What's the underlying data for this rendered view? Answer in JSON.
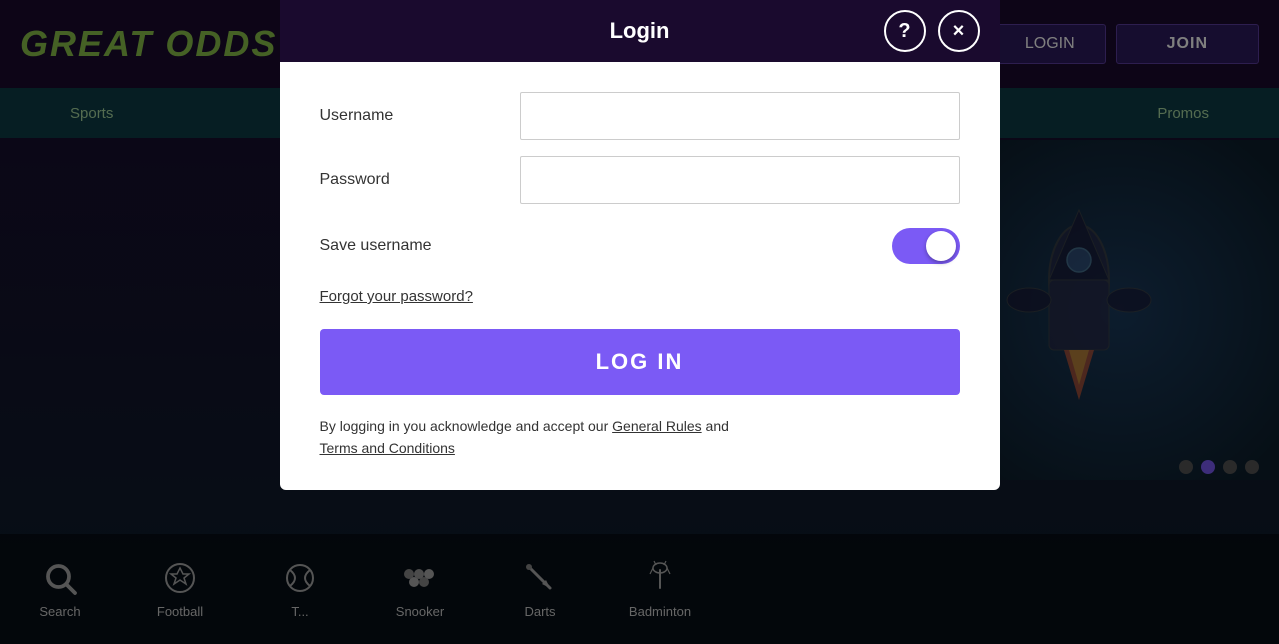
{
  "app": {
    "title": "Great Odds",
    "logo_text": "GREAT ODDS"
  },
  "header": {
    "login_label": "LOGIN",
    "join_label": "JOIN"
  },
  "nav": {
    "sports_label": "Sports",
    "promos_label": "Promos"
  },
  "sports_bar": {
    "items": [
      {
        "id": "search",
        "label": "Search",
        "icon": "search"
      },
      {
        "id": "football",
        "label": "Football",
        "icon": "football"
      },
      {
        "id": "tennis",
        "label": "T...",
        "icon": "tennis"
      },
      {
        "id": "snooker",
        "label": "Snooker",
        "icon": "snooker"
      },
      {
        "id": "darts",
        "label": "Darts",
        "icon": "darts"
      },
      {
        "id": "badminton",
        "label": "Badminton",
        "icon": "badminton"
      }
    ]
  },
  "modal": {
    "title": "Login",
    "username_label": "Username",
    "username_placeholder": "",
    "password_label": "Password",
    "password_placeholder": "",
    "save_username_label": "Save username",
    "toggle_on": true,
    "forgot_password_label": "Forgot your password?",
    "login_button_label": "LOG IN",
    "terms_text_prefix": "By logging in you acknowledge and accept our",
    "general_rules_label": "General Rules",
    "terms_and": "and",
    "terms_conditions_label": "Terms and Conditions",
    "help_icon": "?",
    "close_icon": "×"
  },
  "carousel": {
    "dots": [
      {
        "active": false
      },
      {
        "active": true
      },
      {
        "active": false
      },
      {
        "active": false
      }
    ]
  }
}
